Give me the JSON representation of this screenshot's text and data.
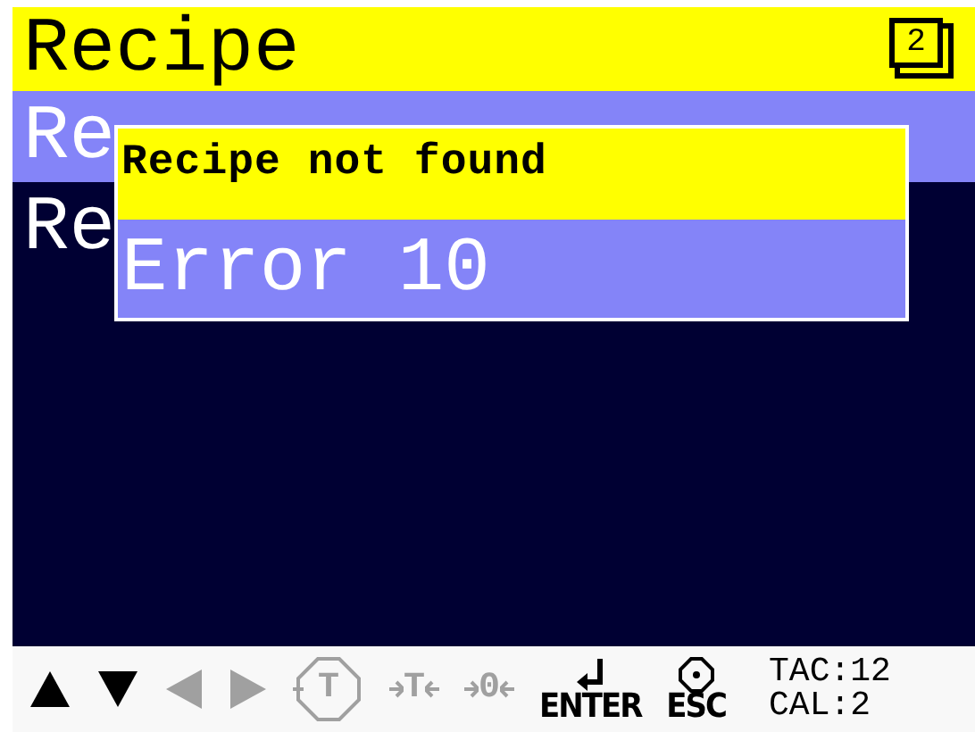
{
  "header": {
    "title": "Recipe",
    "page": "2"
  },
  "rows": [
    {
      "text": "Re",
      "selected": true
    },
    {
      "text": "Re",
      "selected": false
    }
  ],
  "dialog": {
    "title": "Recipe not found",
    "message": "Error 10"
  },
  "keys": [
    {
      "kind": "up",
      "disabled": false
    },
    {
      "kind": "down",
      "disabled": false
    },
    {
      "kind": "left",
      "disabled": true
    },
    {
      "kind": "right",
      "disabled": true
    },
    {
      "kind": "tare-box",
      "glyph": "T",
      "disabled": true
    },
    {
      "kind": "tare-arrows",
      "glyph": "T",
      "disabled": true
    },
    {
      "kind": "zero-arrows",
      "glyph": "0",
      "disabled": true
    },
    {
      "kind": "enter",
      "label": "ENTER",
      "disabled": false
    },
    {
      "kind": "esc",
      "label": "ESC",
      "disabled": false
    }
  ],
  "status": [
    "TAC:12",
    "CAL:2"
  ]
}
